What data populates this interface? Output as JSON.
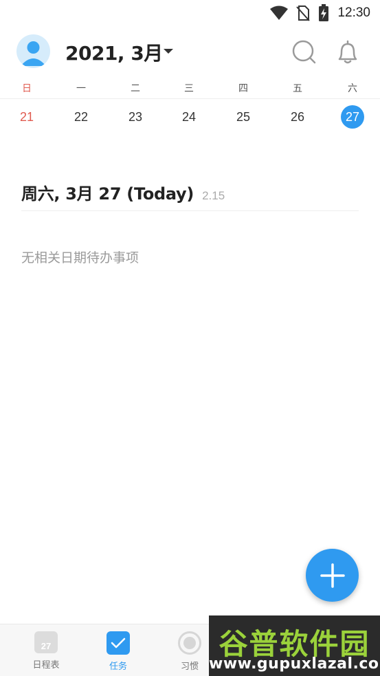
{
  "status_bar": {
    "time": "12:30",
    "icons": [
      "wifi-icon",
      "no-sim-icon",
      "battery-charging-icon"
    ]
  },
  "header": {
    "month_title": "2021, 3月",
    "avatar_icon": "user-avatar-icon",
    "search_icon": "search-icon",
    "bell_icon": "bell-icon"
  },
  "week": {
    "weekdays": [
      "日",
      "一",
      "二",
      "三",
      "四",
      "五",
      "六"
    ],
    "days": [
      "21",
      "22",
      "23",
      "24",
      "25",
      "26",
      "27"
    ],
    "today_index": 6
  },
  "agenda": {
    "date_heading": "周六, 3月 27 (Today)",
    "date_sub": "2.15",
    "empty_text": "无相关日期待办事项"
  },
  "fab": {
    "icon": "plus-icon"
  },
  "bottom_nav": {
    "items": [
      {
        "label": "日程表",
        "icon": "calendar-icon",
        "badge": "27",
        "active": false
      },
      {
        "label": "任务",
        "icon": "checkbox-icon",
        "active": true
      },
      {
        "label": "习惯",
        "icon": "habit-icon",
        "active": false
      }
    ]
  },
  "watermark": {
    "logo": "谷普软件园",
    "url": "www.gupuxlazal.com"
  },
  "colors": {
    "accent": "#2f9af0",
    "sunday": "#e05a4f",
    "muted": "#9a9a9a"
  }
}
